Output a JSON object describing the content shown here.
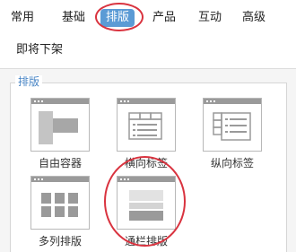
{
  "tabs": [
    {
      "label": "常用",
      "active": false
    },
    {
      "label": "基础",
      "active": false
    },
    {
      "label": "排版",
      "active": true
    },
    {
      "label": "产品",
      "active": false
    },
    {
      "label": "互动",
      "active": false
    },
    {
      "label": "高级",
      "active": false
    },
    {
      "label": "即将下架",
      "active": false
    }
  ],
  "group": {
    "title": "排版",
    "items": [
      {
        "label": "自由容器",
        "icon": "free-container-icon"
      },
      {
        "label": "横向标签",
        "icon": "horizontal-tabs-icon"
      },
      {
        "label": "纵向标签",
        "icon": "vertical-tabs-icon"
      },
      {
        "label": "多列排版",
        "icon": "multi-column-icon"
      },
      {
        "label": "通栏排版",
        "icon": "full-width-layout-icon"
      }
    ]
  },
  "colors": {
    "accent": "#5b9bd5",
    "highlight_ring": "#d9333f",
    "icon_gray": "#9a9a9a",
    "group_title": "#4a86c5"
  }
}
